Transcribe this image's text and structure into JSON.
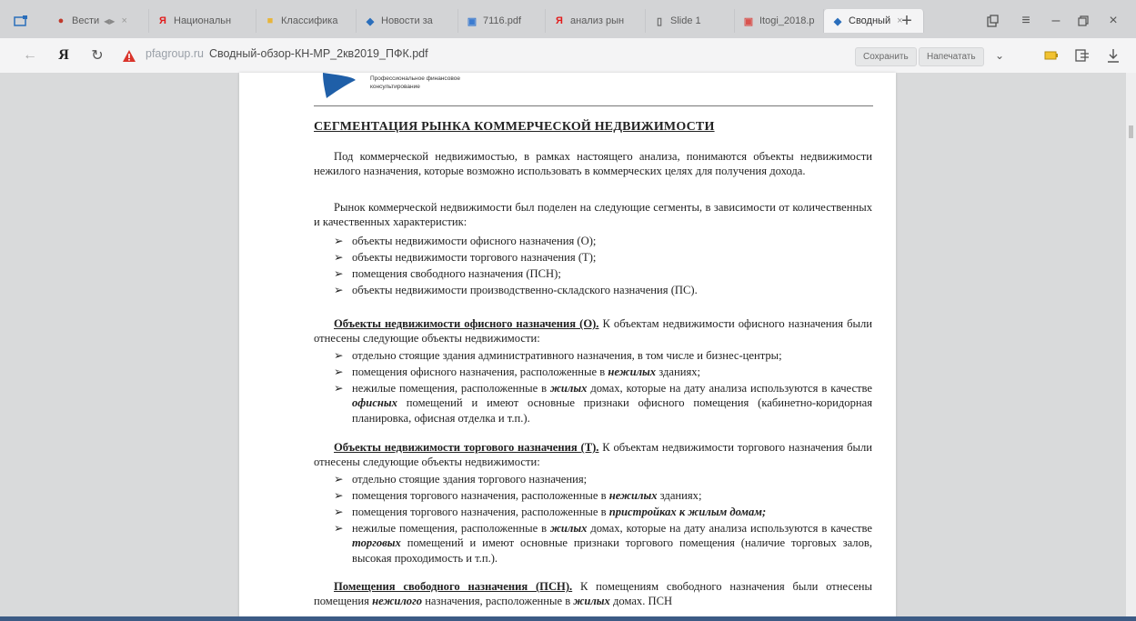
{
  "tabs": [
    {
      "label": "Вести",
      "extra": "◀▶",
      "icon": "flag-icon",
      "color": "#c0392b"
    },
    {
      "label": "Национальн",
      "icon": "yandex-icon",
      "color": "#e21b1b"
    },
    {
      "label": "Классифика",
      "icon": "folder-icon",
      "color": "#e8b53a"
    },
    {
      "label": "Новости за",
      "icon": "news-icon",
      "color": "#2a6ebb"
    },
    {
      "label": "7116.pdf",
      "icon": "pdf-icon",
      "color": "#3b7bd0"
    },
    {
      "label": "анализ рын",
      "icon": "yandex-icon",
      "color": "#e21b1b"
    },
    {
      "label": "Slide 1",
      "icon": "page-icon",
      "color": "#666666"
    },
    {
      "label": "Itogi_2018.p",
      "icon": "pdf-icon",
      "color": "#d9534f"
    },
    {
      "label": "Сводный",
      "icon": "site-icon",
      "color": "#2a6ebb",
      "active": true
    }
  ],
  "addressbar": {
    "domain": "pfagroup.ru",
    "title": "Сводный-обзор-КН-МР_2кв2019_ПФК.pdf",
    "save_label": "Сохранить",
    "print_label": "Напечатать"
  },
  "doc": {
    "logo_text_1": "Профессиональное финансовое",
    "logo_text_2": "консультирование",
    "heading": "СЕГМЕНТАЦИЯ РЫНКА КОММЕРЧЕСКОЙ НЕДВИЖИМОСТИ",
    "p1": "Под коммерческой недвижимостью, в рамках настоящего анализа, понимаются объекты недвижимости нежилого назначения, которые возможно использовать в коммерческих целях для получения дохода.",
    "p2": "Рынок коммерческой недвижимости был поделен на следующие сегменты, в зависимости от количественных и качественных характеристик:",
    "segments": [
      "объекты недвижимости офисного назначения (О);",
      "объекты недвижимости торгового назначения (Т);",
      "помещения свободного назначения (ПСН);",
      "объекты недвижимости производственно-складского назначения (ПС)."
    ],
    "office_head": "Объекты недвижимости офисного назначения (О).",
    "office_text": " К объектам недвижимости офисного назначения были отнесены следующие объекты недвижимости:",
    "office_items": [
      "отдельно стоящие здания административного назначения, в том числе и бизнес-центры;",
      "помещения офисного назначения, расположенные в",
      "нежилые помещения, расположенные в"
    ],
    "office_item2_em": "нежилых",
    "office_item2_tail": " зданиях;",
    "office_item3_em": "жилых",
    "office_item3_mid": " домах, которые на дату анализа используются в качестве ",
    "office_item3_em2": "офисных",
    "office_item3_tail": " помещений и имеют основные признаки офисного помещения (кабинетно-коридорная планировка, офисная отделка и т.п.).",
    "trade_head": "Объекты недвижимости торгового назначения (Т).",
    "trade_text": " К объектам недвижимости торгового назначения были отнесены следующие объекты недвижимости:",
    "trade_items": [
      "отдельно стоящие здания торгового назначения;",
      "помещения торгового назначения, расположенные в",
      "помещения торгового назначения, расположенные в",
      "нежилые помещения, расположенные в"
    ],
    "trade_item2_em": "нежилых",
    "trade_item2_tail": " зданиях;",
    "trade_item3_em": "пристройках к жилым домам;",
    "trade_item4_em": "жилых",
    "trade_item4_mid": " домах, которые на дату анализа используются в качестве ",
    "trade_item4_em2": "торговых",
    "trade_item4_tail": " помещений и имеют основные признаки торгового помещения (наличие торговых залов, высокая проходимость и т.п.).",
    "psn_head": "Помещения свободного назначения (ПСН).",
    "psn_text": " К помещениям свободного назначения были отнесены помещения ",
    "psn_em": "нежилого",
    "psn_mid": " назначения, расположенные в ",
    "psn_em2": "жилых",
    "psn_tail": " домах. ПСН"
  },
  "colors": {
    "accent": "#1f5fa8"
  }
}
